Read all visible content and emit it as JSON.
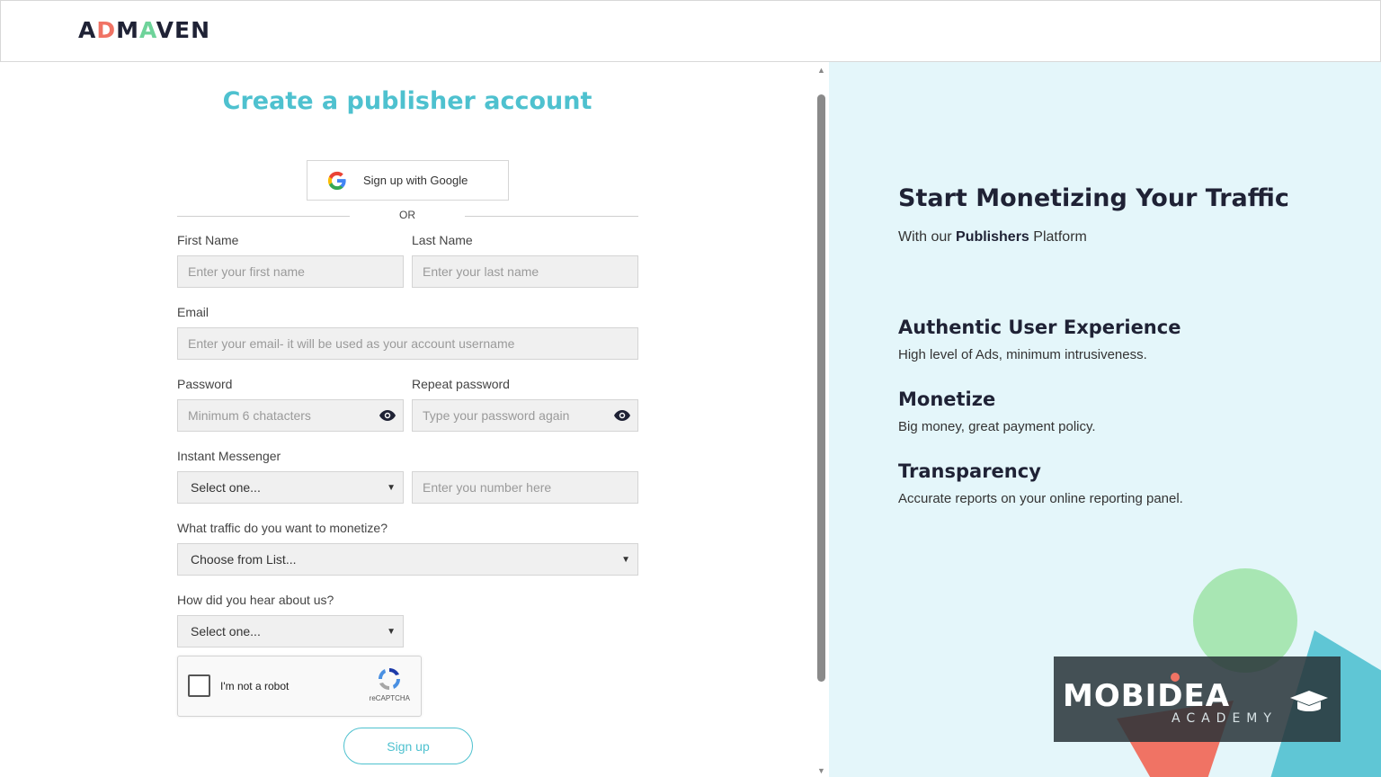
{
  "header": {
    "logo_text": "ADMAVEN"
  },
  "form": {
    "title": "Create a publisher account",
    "google_button": "Sign up with Google",
    "or_text": "OR",
    "first_name": {
      "label": "First Name",
      "placeholder": "Enter your first name"
    },
    "last_name": {
      "label": "Last Name",
      "placeholder": "Enter your last name"
    },
    "email": {
      "label": "Email",
      "placeholder": "Enter your email- it will be used as your account username"
    },
    "password": {
      "label": "Password",
      "placeholder": "Minimum 6 chatacters"
    },
    "repeat_password": {
      "label": "Repeat password",
      "placeholder": "Type your password again"
    },
    "messenger": {
      "label": "Instant Messenger",
      "select_value": "Select one...",
      "number_placeholder": "Enter you number here"
    },
    "traffic": {
      "label": "What traffic do you want to monetize?",
      "select_value": "Choose from List..."
    },
    "hear": {
      "label": "How did you hear about us?",
      "select_value": "Select one..."
    },
    "captcha": {
      "text": "I'm not a robot",
      "brand": "reCAPTCHA"
    },
    "signup_button": "Sign up"
  },
  "promo": {
    "title": "Start Monetizing Your Traffic",
    "subtitle_pre": "With our ",
    "subtitle_bold": "Publishers",
    "subtitle_post": " Platform",
    "features": [
      {
        "heading": "Authentic User Experience",
        "text": "High level of Ads, minimum intrusiveness."
      },
      {
        "heading": "Monetize",
        "text": "Big money, great payment policy."
      },
      {
        "heading": "Transparency",
        "text": "Accurate reports on your online reporting panel."
      }
    ],
    "watermark": {
      "line1": "MOBIDEA",
      "line2": "ACADEMY"
    }
  },
  "colors": {
    "accent": "#4ec1cf",
    "dark": "#1f2235",
    "panel_bg": "#e4f6fa"
  }
}
